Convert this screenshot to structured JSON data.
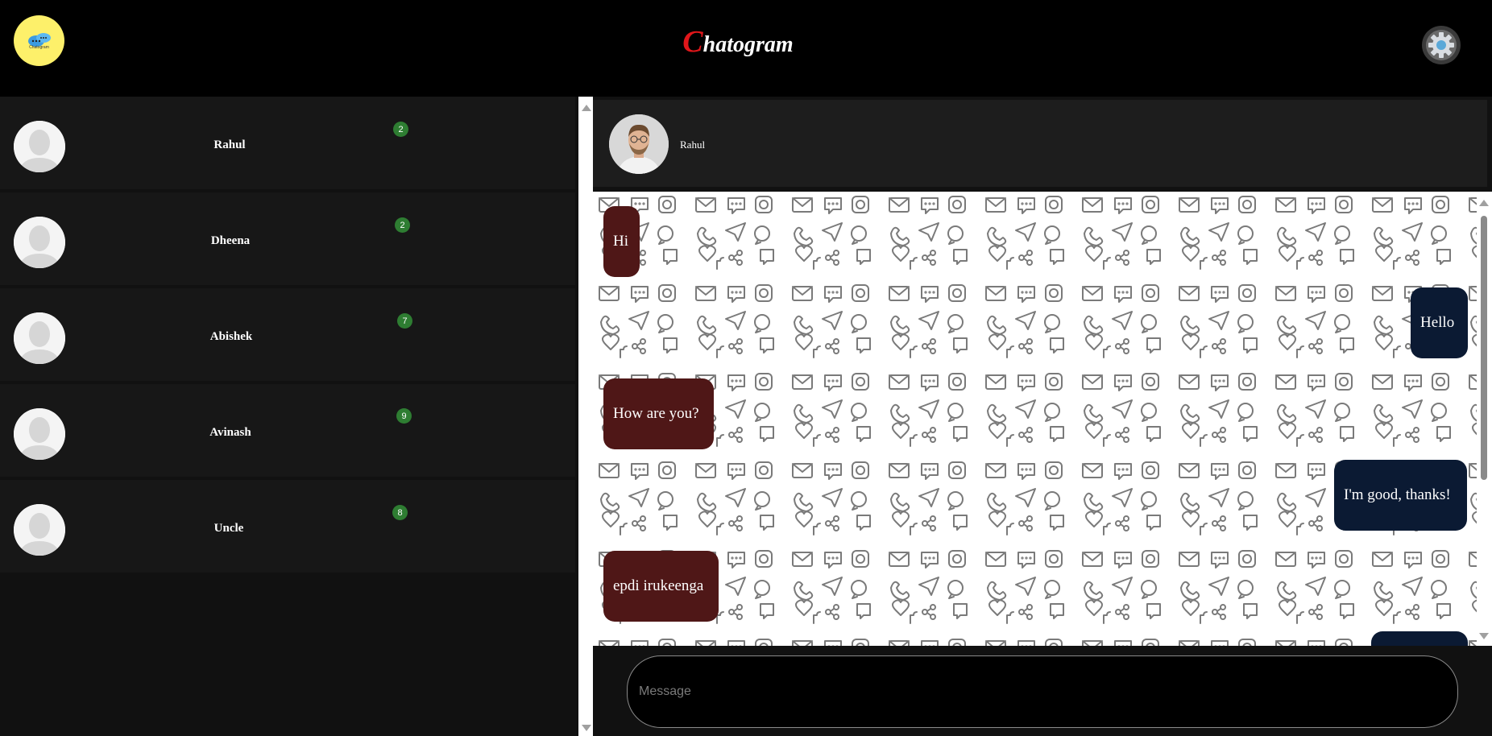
{
  "header": {
    "logo_caption": "Chatogram",
    "title_first_letter": "C",
    "title_rest": "hatogram",
    "accent_color": "#e0161a",
    "settings_icon": "gear-icon"
  },
  "contacts": [
    {
      "name": "Rahul",
      "unread": "2"
    },
    {
      "name": "Dheena",
      "unread": "2"
    },
    {
      "name": "Abishek",
      "unread": "7"
    },
    {
      "name": "Avinash",
      "unread": "9"
    },
    {
      "name": "Uncle",
      "unread": "8"
    }
  ],
  "chat": {
    "active_contact": "Rahul",
    "messages": [
      {
        "direction": "incoming",
        "text": "Hi"
      },
      {
        "direction": "outgoing",
        "text": "Hello"
      },
      {
        "direction": "incoming",
        "text": "How are you?"
      },
      {
        "direction": "outgoing",
        "text": "I'm good, thanks!"
      },
      {
        "direction": "incoming",
        "text": "epdi irukeenga"
      }
    ],
    "incoming_color": "#4f1717",
    "outgoing_color": "#0b1a33"
  },
  "composer": {
    "placeholder": "Message"
  }
}
